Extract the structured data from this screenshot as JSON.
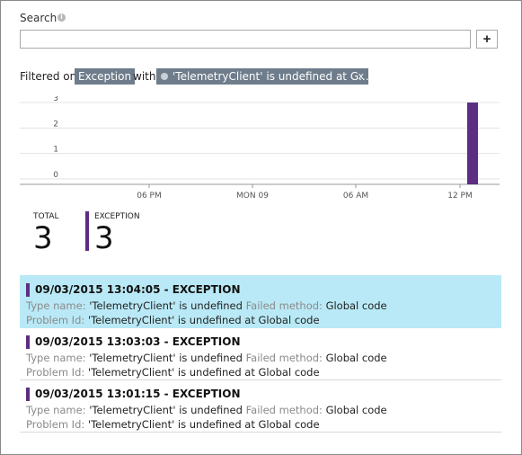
{
  "search": {
    "label": "Search",
    "info_icon": "info-icon",
    "value": "",
    "placeholder": "",
    "add_button_label": "+"
  },
  "filter": {
    "prefix": "Filtered on",
    "chip1": "Exception",
    "with": "with",
    "chip2": "'TelemetryClient' is undefined at G...",
    "chip2_close": "x"
  },
  "chart_data": {
    "type": "bar",
    "title": "",
    "y_ticks": [
      "3",
      "2",
      "1",
      "0"
    ],
    "ylim": [
      0,
      3
    ],
    "x_ticks": [
      "06 PM",
      "MON 09",
      "06 AM",
      "12 PM"
    ],
    "series": [
      {
        "name": "EXCEPTION",
        "color": "#5c2d82",
        "points": [
          {
            "x": "12 PM",
            "y": 3
          }
        ]
      }
    ],
    "grid": true
  },
  "stats": {
    "total_label": "TOTAL",
    "total_value": "3",
    "exception_label": "EXCEPTION",
    "exception_value": "3",
    "accent": "#5c2d82"
  },
  "results": [
    {
      "title": "09/03/2015 13:04:05 - EXCEPTION",
      "type_key": "Type name:",
      "type_value": "'TelemetryClient' is undefined",
      "method_key": "Failed method:",
      "method_value": "Global code",
      "problem_key": "Problem Id:",
      "problem_value": "'TelemetryClient' is undefined at Global code",
      "selected": true
    },
    {
      "title": "09/03/2015 13:03:03 - EXCEPTION",
      "type_key": "Type name:",
      "type_value": "'TelemetryClient' is undefined",
      "method_key": "Failed method:",
      "method_value": "Global code",
      "problem_key": "Problem Id:",
      "problem_value": "'TelemetryClient' is undefined at Global code",
      "selected": false
    },
    {
      "title": "09/03/2015 13:01:15 - EXCEPTION",
      "type_key": "Type name:",
      "type_value": "'TelemetryClient' is undefined",
      "method_key": "Failed method:",
      "method_value": "Global code",
      "problem_key": "Problem Id:",
      "problem_value": "'TelemetryClient' is undefined at Global code",
      "selected": false
    }
  ]
}
